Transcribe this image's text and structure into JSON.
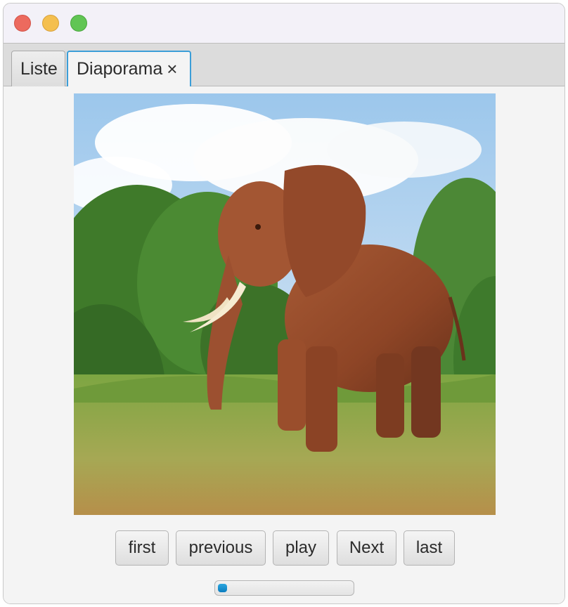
{
  "window": {
    "controls": [
      "close",
      "minimize",
      "zoom"
    ]
  },
  "tabs": [
    {
      "label": "Liste",
      "selected": false
    },
    {
      "label": "Diaporama",
      "selected": true,
      "close_icon": "×"
    }
  ],
  "slideshow": {
    "image": {
      "subject": "elephant",
      "icon": "photo"
    },
    "buttons": {
      "first": "first",
      "previous": "previous",
      "play": "play",
      "next": "Next",
      "last": "last"
    },
    "progress": {
      "fraction": 0.07,
      "fill_color": "#1e93d2"
    }
  },
  "colors": {
    "accent": "#3b9ed8",
    "traffic_close": "#ec6a5e",
    "traffic_minimize": "#f4bf4f",
    "traffic_zoom": "#61c554"
  }
}
